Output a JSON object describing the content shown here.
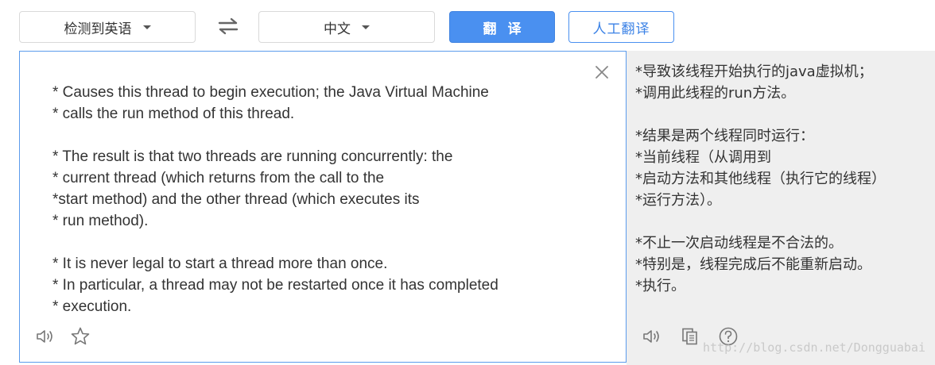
{
  "toolbar": {
    "source_language": "检测到英语",
    "target_language": "中文",
    "translate_label": "翻译",
    "human_translate_label": "人工翻译"
  },
  "source": {
    "text": "* Causes this thread to begin execution; the Java Virtual Machine\n* calls the run method of this thread.\n\n* The result is that two threads are running concurrently: the\n* current thread (which returns from the call to the\n*start method) and the other thread (which executes its\n* run method).\n\n* It is never legal to start a thread more than once.\n* In particular, a thread may not be restarted once it has completed\n* execution."
  },
  "target": {
    "text": "*导致该线程开始执行的java虚拟机；\n*调用此线程的run方法。\n\n*结果是两个线程同时运行：\n*当前线程（从调用到\n*启动方法和其他线程（执行它的线程）\n*运行方法）。\n\n*不止一次启动线程是不合法的。\n*特别是，线程完成后不能重新启动。\n*执行。",
    "watermark": "http://blog.csdn.net/Dongguabai"
  },
  "icons": {
    "swap": "swap-arrows-icon",
    "close": "close-icon",
    "speaker": "speaker-icon",
    "star": "star-icon",
    "copy": "copy-icon",
    "help": "help-icon"
  },
  "colors": {
    "accent": "#4a90f0",
    "panel_border": "#5b9bec",
    "result_bg": "#efefef"
  }
}
